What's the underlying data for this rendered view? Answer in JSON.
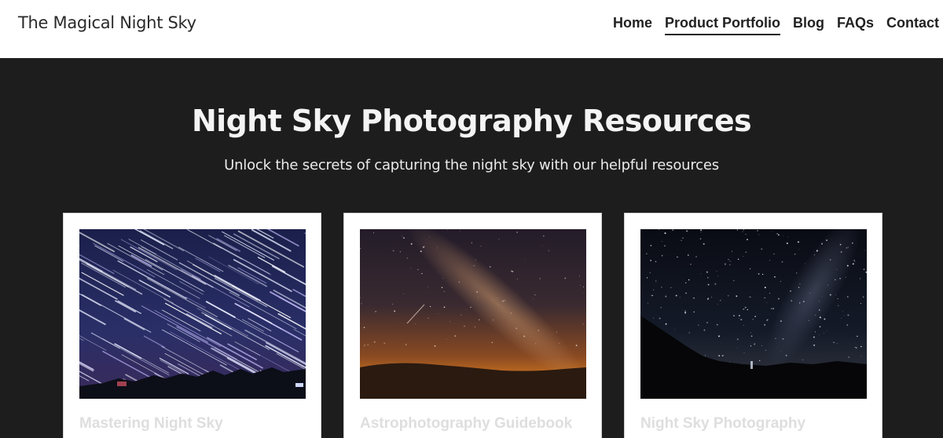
{
  "header": {
    "site_title": "The Magical Night Sky",
    "nav": [
      {
        "label": "Home",
        "active": false
      },
      {
        "label": "Product Portfolio",
        "active": true
      },
      {
        "label": "Blog",
        "active": false
      },
      {
        "label": "FAQs",
        "active": false
      },
      {
        "label": "Contact",
        "active": false
      }
    ]
  },
  "hero": {
    "title": "Night Sky Photography Resources",
    "subtitle": "Unlock the secrets of capturing the night sky with our helpful resources"
  },
  "cards": [
    {
      "title": "Mastering Night Sky",
      "image": "star-trails-photo"
    },
    {
      "title": "Astrophotography Guidebook",
      "image": "milky-way-sunset-photo"
    },
    {
      "title": "Night Sky Photography",
      "image": "starry-night-hills-photo"
    }
  ],
  "colors": {
    "header_bg": "#ffffff",
    "hero_bg": "#1d1d1d",
    "card_bg": "#ffffff",
    "card_title": "#dedede"
  }
}
